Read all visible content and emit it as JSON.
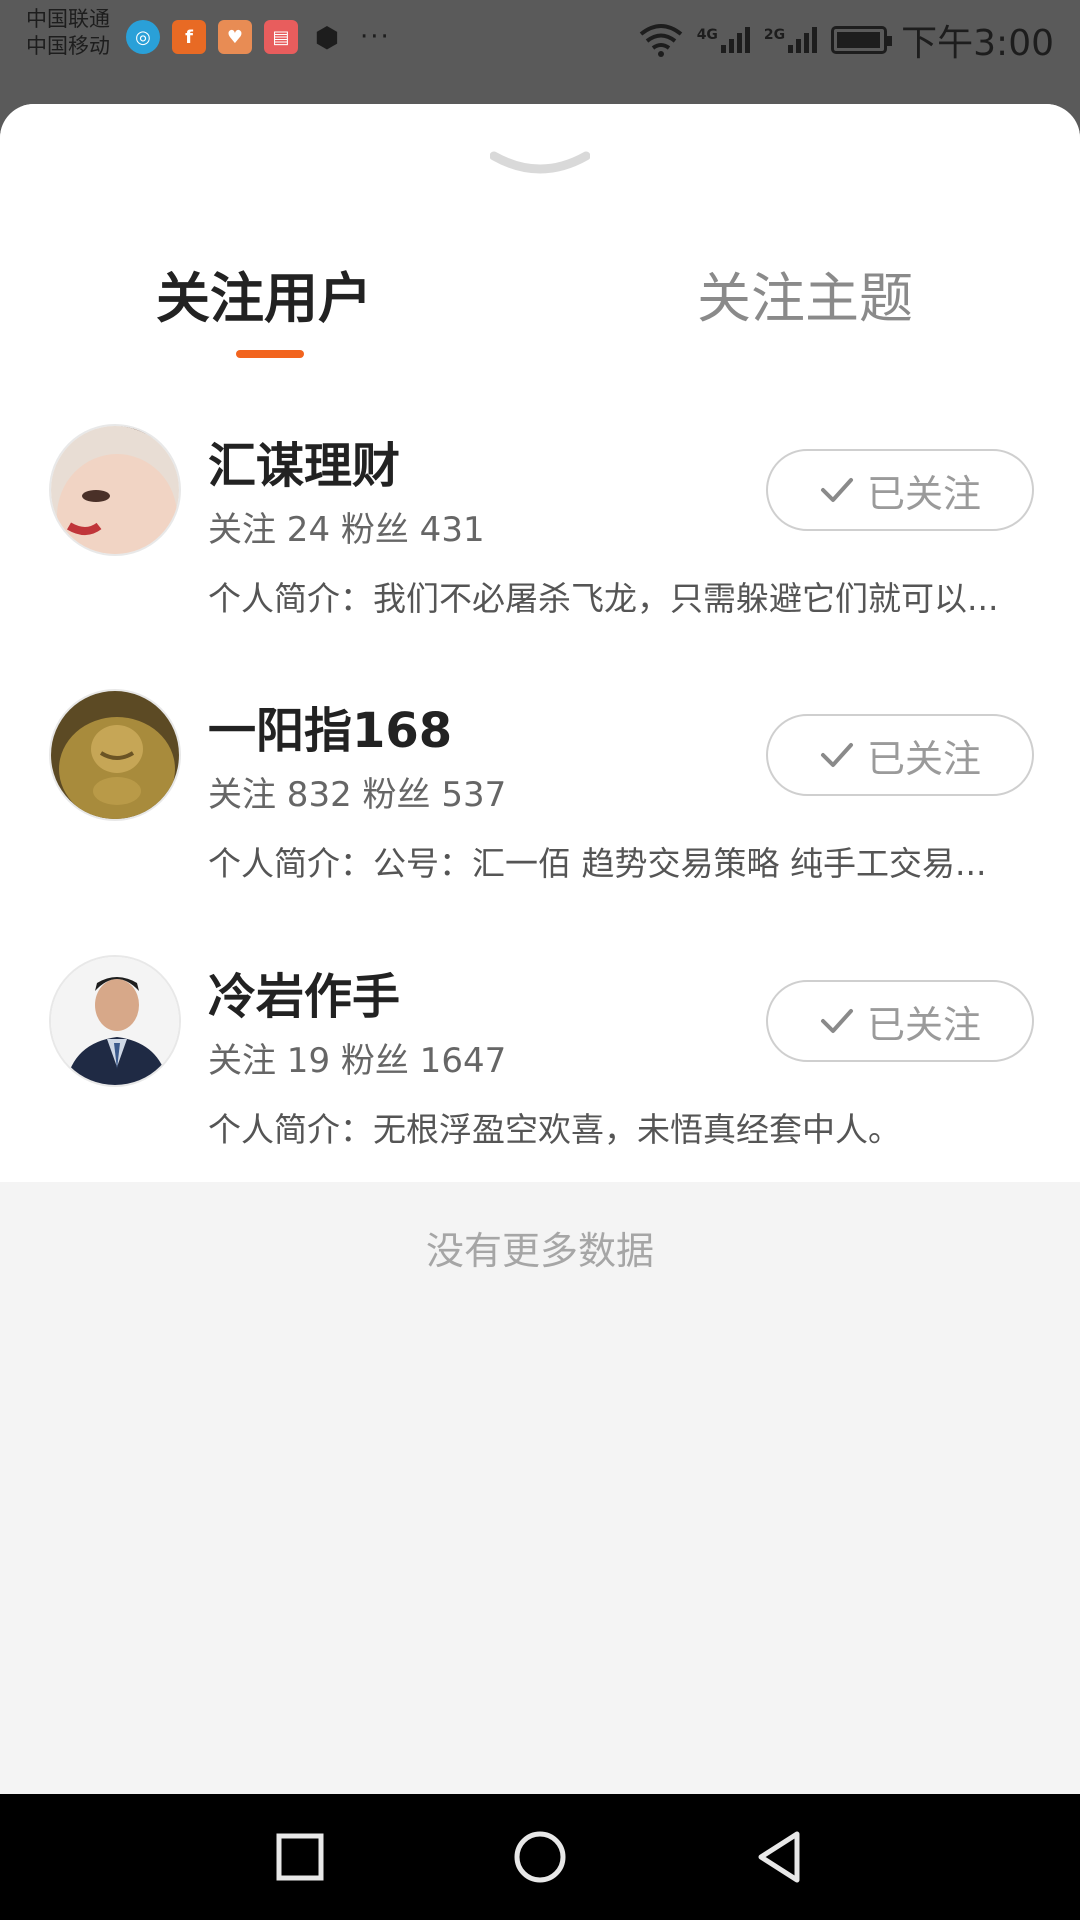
{
  "status_bar": {
    "carrier_1": "中国联通",
    "carrier_2": "中国移动",
    "network_1": "4G",
    "network_2": "2G",
    "time": "下午3:00",
    "more": "···",
    "app_icons": [
      "chat-app-icon",
      "f-app-icon",
      "heart-app-icon",
      "book-app-icon",
      "hand-app-icon"
    ]
  },
  "tabs": [
    {
      "label": "关注用户",
      "active": true
    },
    {
      "label": "关注主题",
      "active": false
    }
  ],
  "users": [
    {
      "name": "汇谋理财",
      "stats": "关注 24 粉丝 431",
      "bio": "个人简介：我们不必屠杀飞龙，只需躲避它们就可以...",
      "button": "已关注"
    },
    {
      "name": "一阳指168",
      "stats": "关注 832 粉丝 537",
      "bio": "个人简介：公号：汇一佰 趋势交易策略 纯手工交易...",
      "button": "已关注"
    },
    {
      "name": "冷岩作手",
      "stats": "关注 19 粉丝 1647",
      "bio": "个人简介：无根浮盈空欢喜，未悟真经套中人。",
      "button": "已关注"
    }
  ],
  "footer": {
    "no_more": "没有更多数据"
  },
  "colors": {
    "accent": "#f2641e",
    "status_bar_bg": "#5a5a5a"
  }
}
